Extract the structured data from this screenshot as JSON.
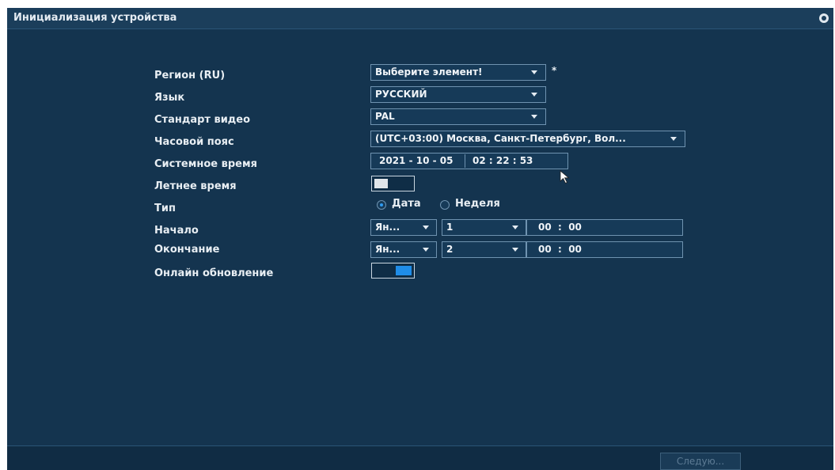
{
  "window": {
    "title": "Инициализация устройства"
  },
  "form": {
    "region": {
      "label": "Регион (RU)",
      "value": "Выберите элемент!",
      "required_mark": "*"
    },
    "language": {
      "label": "Язык",
      "value": "РУССКИЙ"
    },
    "video_standard": {
      "label": "Стандарт видео",
      "value": "PAL"
    },
    "timezone": {
      "label": "Часовой пояс",
      "value": "(UTC+03:00) Москва, Санкт-Петербург, Вол..."
    },
    "system_time": {
      "label": "Системное время",
      "date": "2021 - 10 - 05",
      "time": "02 : 22 : 53"
    },
    "dst": {
      "label": "Летнее время",
      "enabled": false
    },
    "type": {
      "label": "Тип",
      "options": [
        "Дата",
        "Неделя"
      ],
      "selected": "Дата"
    },
    "start": {
      "label": "Начало",
      "month": "Ян...",
      "day": "1",
      "time": "00  :  00"
    },
    "end": {
      "label": "Окончание",
      "month": "Ян...",
      "day": "2",
      "time": "00  :  00"
    },
    "online_update": {
      "label": "Онлайн обновление",
      "enabled": true
    }
  },
  "footer": {
    "next_label": "Следую..."
  }
}
